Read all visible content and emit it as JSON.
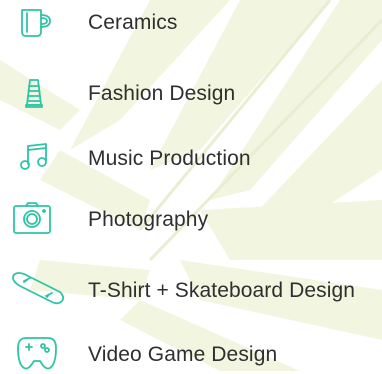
{
  "categories": [
    {
      "label": "Ceramics",
      "icon": "mug-icon"
    },
    {
      "label": "Fashion Design",
      "icon": "thread-spool-icon"
    },
    {
      "label": "Music Production",
      "icon": "music-note-icon"
    },
    {
      "label": "Photography",
      "icon": "camera-icon"
    },
    {
      "label": "T-Shirt + Skateboard Design",
      "icon": "skateboard-icon"
    },
    {
      "label": "Video Game Design",
      "icon": "game-controller-icon"
    }
  ],
  "colors": {
    "icon": "#2ec4a6",
    "text": "#2f2f2f",
    "background_leaf": "#f2f5df"
  }
}
